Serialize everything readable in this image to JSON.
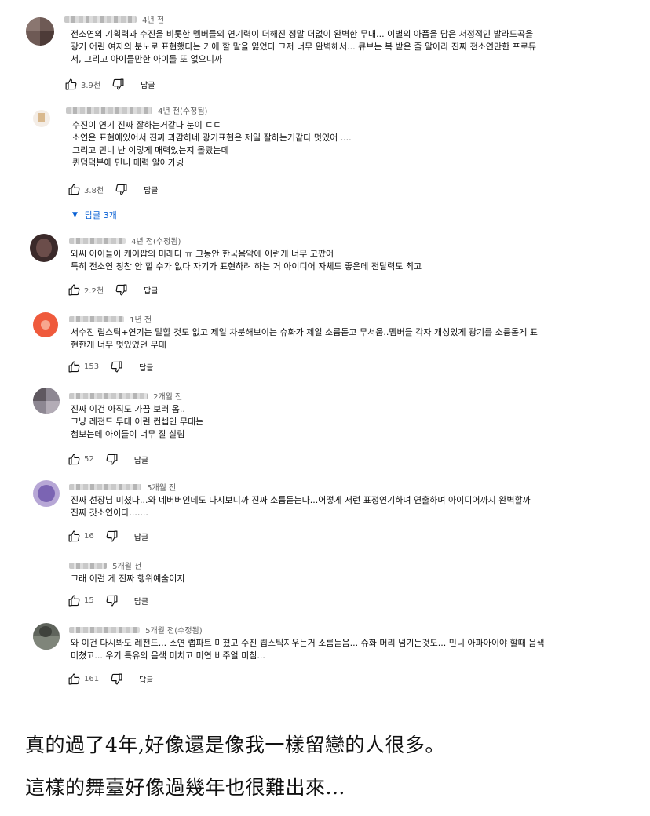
{
  "comments": [
    {
      "time": "4년 전",
      "text": "전소연의 기획력과 수진을 비롯한 멤버들의 연기력이 더해진 정말 더없이 완벽한 무대... 이별의 아픔을 담은 서정적인 발라드곡을\n광기 어린 여자의 분노로 표현했다는 거에 할 말을 잃었다 그저 너무 완벽해서... 큐브는 복 받은 줄 알아라 진짜 전소연만한 프로듀\n서, 그리고 아이들만한 아이돌 또 없으니까",
      "likes": "3.9천",
      "reply": "답글"
    },
    {
      "time": "4년 전(수정됨)",
      "text": "수진이 연기 진짜 잘하는거같다 눈이 ㄷㄷ\n소연은 표현에있어서 진짜 과감하네 광기표현은 제일 잘하는거같다 멋있어 ....\n그리고 민니 난 이렇게 매력있는지 몰랐는데\n퀸덤덕분에 민니 매력 알아가넹",
      "likes": "3.8천",
      "reply": "답글"
    },
    {
      "time": "4년 전(수정됨)",
      "text": "와씨 아이들이 케이팝의 미래다 ㅠ 그동안 한국음악에 이런게 너무 고팠어\n특히 전소연 칭찬 안 할 수가 없다 자기가 표현하려 하는 거 아이디어 자체도 좋은데 전달력도 최고",
      "likes": "2.2천",
      "reply": "답글"
    },
    {
      "time": "1년 전",
      "text": "서수진 립스틱+연기는 말할 것도 없고 제일 차분해보이는 슈화가 제일 소름돋고 무서움..멤버들 각자 개성있게 광기를 소름돋게 표\n현한게 너무 멋있었던 무대",
      "likes": "153",
      "reply": "답글"
    },
    {
      "time": "2개월 전",
      "text": "진짜 이건 아직도 가끔 보러 옴..\n그냥 레전드 무대 이런 컨셉인 무대는\n첨보는데 아이들이 너무 잘 살림",
      "likes": "52",
      "reply": "답글"
    },
    {
      "time": "5개월 전",
      "text": "진짜 선장님 미쳤다...와 네버버인데도 다시보니까 진짜 소름돋는다...어떻게 저런 표정연기하며 연출하며 아이디어까지 완벽할까\n진짜 갓소연이다.......",
      "likes": "16",
      "reply": "답글"
    },
    {
      "time": "5개월 전",
      "text": "그래 이런 게 진짜 행위예술이지",
      "likes": "15",
      "reply": "답글"
    },
    {
      "time": "5개월 전(수정됨)",
      "text": "와 이건 다시봐도 레전드... 소연 랩파트 미쳤고 수진 립스틱지우는거 소름돋음... 슈화 머리 넘기는것도... 민니 아파아이야 할때 음색\n미쳤고... 우기 특유의 음색 미치고 미연 비주얼 미침...",
      "likes": "161",
      "reply": "답글"
    }
  ],
  "show_replies": "답글 3개",
  "caption": {
    "line1": "真的過了4年,好像還是像我一樣留戀的人很多。",
    "line2": "這樣的舞臺好像過幾年也很難出來..."
  },
  "colors": {
    "link": "#065fd4",
    "meta": "#606060",
    "text": "#0f0f0f"
  },
  "icons": [
    "thumb-up-icon",
    "thumb-down-icon",
    "chevron-down-icon"
  ]
}
